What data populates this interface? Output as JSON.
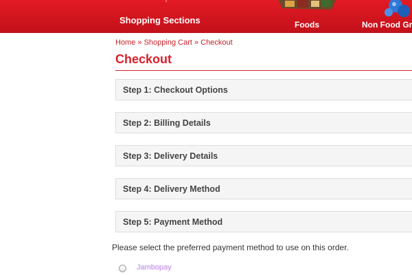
{
  "header": {
    "sections_title": "Shopping Sections",
    "nav": [
      {
        "label": "Foods"
      },
      {
        "label": "Non Food Gro"
      }
    ]
  },
  "breadcrumb": {
    "items": [
      "Home",
      "Shopping Cart",
      "Checkout"
    ],
    "separator": "»"
  },
  "page": {
    "title": "Checkout"
  },
  "checkout_steps": [
    {
      "label": "Step 1: Checkout Options"
    },
    {
      "label": "Step 2: Billing Details"
    },
    {
      "label": "Step 3: Delivery Details"
    },
    {
      "label": "Step 4: Delivery Method"
    },
    {
      "label": "Step 5: Payment Method"
    }
  ],
  "payment": {
    "prompt": "Please select the preferred payment method to use on this order.",
    "option_label": "Jambopay"
  },
  "colors": {
    "header_red": "#d41920",
    "accent_red": "#d8202a",
    "panel_bg": "#f5f5f5"
  }
}
